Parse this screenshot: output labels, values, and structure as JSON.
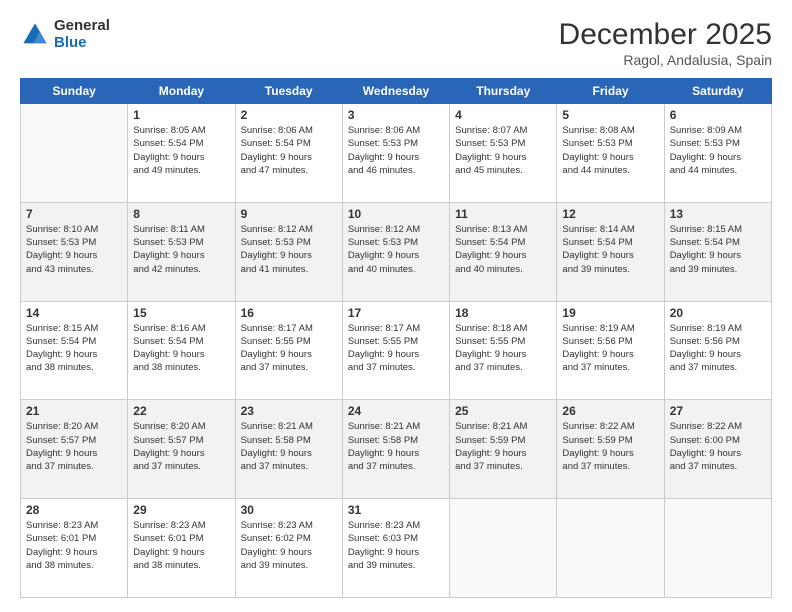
{
  "header": {
    "logo_line1": "General",
    "logo_line2": "Blue",
    "month": "December 2025",
    "location": "Ragol, Andalusia, Spain"
  },
  "days_of_week": [
    "Sunday",
    "Monday",
    "Tuesday",
    "Wednesday",
    "Thursday",
    "Friday",
    "Saturday"
  ],
  "weeks": [
    [
      {
        "day": "",
        "info": ""
      },
      {
        "day": "1",
        "info": "Sunrise: 8:05 AM\nSunset: 5:54 PM\nDaylight: 9 hours\nand 49 minutes."
      },
      {
        "day": "2",
        "info": "Sunrise: 8:06 AM\nSunset: 5:54 PM\nDaylight: 9 hours\nand 47 minutes."
      },
      {
        "day": "3",
        "info": "Sunrise: 8:06 AM\nSunset: 5:53 PM\nDaylight: 9 hours\nand 46 minutes."
      },
      {
        "day": "4",
        "info": "Sunrise: 8:07 AM\nSunset: 5:53 PM\nDaylight: 9 hours\nand 45 minutes."
      },
      {
        "day": "5",
        "info": "Sunrise: 8:08 AM\nSunset: 5:53 PM\nDaylight: 9 hours\nand 44 minutes."
      },
      {
        "day": "6",
        "info": "Sunrise: 8:09 AM\nSunset: 5:53 PM\nDaylight: 9 hours\nand 44 minutes."
      }
    ],
    [
      {
        "day": "7",
        "info": "Sunrise: 8:10 AM\nSunset: 5:53 PM\nDaylight: 9 hours\nand 43 minutes."
      },
      {
        "day": "8",
        "info": "Sunrise: 8:11 AM\nSunset: 5:53 PM\nDaylight: 9 hours\nand 42 minutes."
      },
      {
        "day": "9",
        "info": "Sunrise: 8:12 AM\nSunset: 5:53 PM\nDaylight: 9 hours\nand 41 minutes."
      },
      {
        "day": "10",
        "info": "Sunrise: 8:12 AM\nSunset: 5:53 PM\nDaylight: 9 hours\nand 40 minutes."
      },
      {
        "day": "11",
        "info": "Sunrise: 8:13 AM\nSunset: 5:54 PM\nDaylight: 9 hours\nand 40 minutes."
      },
      {
        "day": "12",
        "info": "Sunrise: 8:14 AM\nSunset: 5:54 PM\nDaylight: 9 hours\nand 39 minutes."
      },
      {
        "day": "13",
        "info": "Sunrise: 8:15 AM\nSunset: 5:54 PM\nDaylight: 9 hours\nand 39 minutes."
      }
    ],
    [
      {
        "day": "14",
        "info": "Sunrise: 8:15 AM\nSunset: 5:54 PM\nDaylight: 9 hours\nand 38 minutes."
      },
      {
        "day": "15",
        "info": "Sunrise: 8:16 AM\nSunset: 5:54 PM\nDaylight: 9 hours\nand 38 minutes."
      },
      {
        "day": "16",
        "info": "Sunrise: 8:17 AM\nSunset: 5:55 PM\nDaylight: 9 hours\nand 37 minutes."
      },
      {
        "day": "17",
        "info": "Sunrise: 8:17 AM\nSunset: 5:55 PM\nDaylight: 9 hours\nand 37 minutes."
      },
      {
        "day": "18",
        "info": "Sunrise: 8:18 AM\nSunset: 5:55 PM\nDaylight: 9 hours\nand 37 minutes."
      },
      {
        "day": "19",
        "info": "Sunrise: 8:19 AM\nSunset: 5:56 PM\nDaylight: 9 hours\nand 37 minutes."
      },
      {
        "day": "20",
        "info": "Sunrise: 8:19 AM\nSunset: 5:56 PM\nDaylight: 9 hours\nand 37 minutes."
      }
    ],
    [
      {
        "day": "21",
        "info": "Sunrise: 8:20 AM\nSunset: 5:57 PM\nDaylight: 9 hours\nand 37 minutes."
      },
      {
        "day": "22",
        "info": "Sunrise: 8:20 AM\nSunset: 5:57 PM\nDaylight: 9 hours\nand 37 minutes."
      },
      {
        "day": "23",
        "info": "Sunrise: 8:21 AM\nSunset: 5:58 PM\nDaylight: 9 hours\nand 37 minutes."
      },
      {
        "day": "24",
        "info": "Sunrise: 8:21 AM\nSunset: 5:58 PM\nDaylight: 9 hours\nand 37 minutes."
      },
      {
        "day": "25",
        "info": "Sunrise: 8:21 AM\nSunset: 5:59 PM\nDaylight: 9 hours\nand 37 minutes."
      },
      {
        "day": "26",
        "info": "Sunrise: 8:22 AM\nSunset: 5:59 PM\nDaylight: 9 hours\nand 37 minutes."
      },
      {
        "day": "27",
        "info": "Sunrise: 8:22 AM\nSunset: 6:00 PM\nDaylight: 9 hours\nand 37 minutes."
      }
    ],
    [
      {
        "day": "28",
        "info": "Sunrise: 8:23 AM\nSunset: 6:01 PM\nDaylight: 9 hours\nand 38 minutes."
      },
      {
        "day": "29",
        "info": "Sunrise: 8:23 AM\nSunset: 6:01 PM\nDaylight: 9 hours\nand 38 minutes."
      },
      {
        "day": "30",
        "info": "Sunrise: 8:23 AM\nSunset: 6:02 PM\nDaylight: 9 hours\nand 39 minutes."
      },
      {
        "day": "31",
        "info": "Sunrise: 8:23 AM\nSunset: 6:03 PM\nDaylight: 9 hours\nand 39 minutes."
      },
      {
        "day": "",
        "info": ""
      },
      {
        "day": "",
        "info": ""
      },
      {
        "day": "",
        "info": ""
      }
    ]
  ]
}
